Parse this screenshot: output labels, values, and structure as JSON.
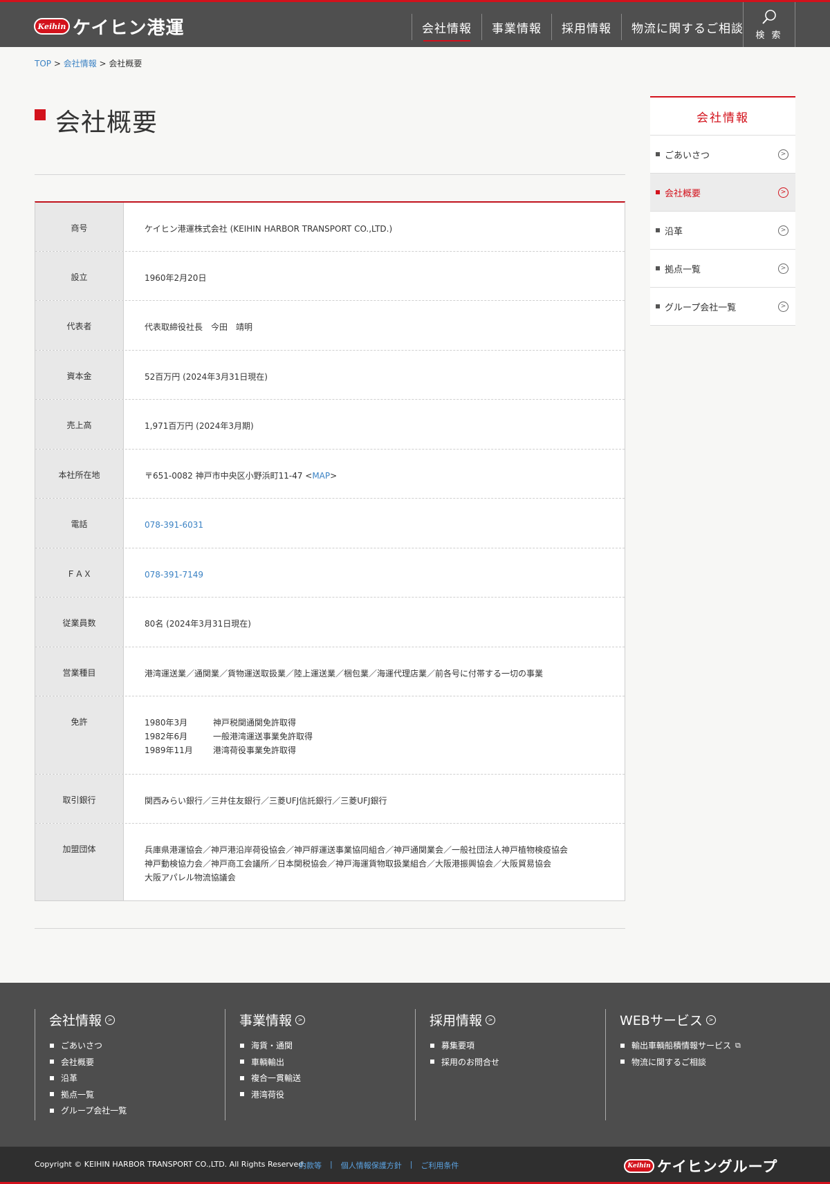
{
  "header": {
    "logo_badge": "Keihin",
    "logo_text": "ケイヒン港運",
    "nav": [
      {
        "label": "会社情報"
      },
      {
        "label": "事業情報"
      },
      {
        "label": "採用情報"
      },
      {
        "label": "物流に関するご相談"
      }
    ],
    "search_label": "検 索"
  },
  "breadcrumb": {
    "top": "TOP",
    "sep1": " > ",
    "company": "会社情報",
    "sep2": " > ",
    "current": "会社概要"
  },
  "page_title": "会社概要",
  "profile": {
    "rows": [
      {
        "label": "商号",
        "value": "ケイヒン港運株式会社 (KEIHIN HARBOR TRANSPORT CO.,LTD.)"
      },
      {
        "label": "設立",
        "value": "1960年2月20日"
      },
      {
        "label": "代表者",
        "value": "代表取締役社長　今田　靖明"
      },
      {
        "label": "資本金",
        "value": "52百万円 (2024年3月31日現在)"
      },
      {
        "label": "売上高",
        "value": "1,971百万円 (2024年3月期)"
      },
      {
        "label": "本社所在地",
        "value": "〒651-0082 神戸市中央区小野浜町11-47 <",
        "link": "MAP",
        "suffix": ">"
      },
      {
        "label": "電話",
        "link": "078-391-6031"
      },
      {
        "label": "ＦＡＸ",
        "link": "078-391-7149"
      },
      {
        "label": "従業員数",
        "value": "80名 (2024年3月31日現在)"
      },
      {
        "label": "営業種目",
        "value": "港湾運送業／通関業／貨物運送取扱業／陸上運送業／梱包業／海運代理店業／前各号に付帯する一切の事業"
      },
      {
        "label": "免許",
        "lines": [
          {
            "date": "1980年3月",
            "text": "神戸税関通関免許取得"
          },
          {
            "date": "1982年6月",
            "text": "一般港湾運送事業免許取得"
          },
          {
            "date": "1989年11月",
            "text": "港湾荷役事業免許取得"
          }
        ]
      },
      {
        "label": "取引銀行",
        "value": "関西みらい銀行／三井住友銀行／三菱UFJ信託銀行／三菱UFJ銀行"
      },
      {
        "label": "加盟団体",
        "lines3": [
          "兵庫県港運協会／神戸港沿岸荷役協会／神戸艀運送事業協同組合／神戸通関業会／一般社団法人神戸植物検疫協会",
          "神戸動検協力会／神戸商工会議所／日本関税協会／神戸海運貨物取扱業組合／大阪港振興協会／大阪貿易協会",
          "大阪アパレル物流協議会"
        ]
      }
    ]
  },
  "sidebar": {
    "title": "会社情報",
    "items": [
      {
        "label": "ごあいさつ"
      },
      {
        "label": "会社概要"
      },
      {
        "label": "沿革"
      },
      {
        "label": "拠点一覧"
      },
      {
        "label": "グループ会社一覧"
      }
    ]
  },
  "footer": {
    "columns": [
      {
        "title": "会社情報",
        "items": [
          "ごあいさつ",
          "会社概要",
          "沿革",
          "拠点一覧",
          "グループ会社一覧"
        ]
      },
      {
        "title": "事業情報",
        "items": [
          "海貨・通関",
          "車輌輸出",
          "複合一貫輸送",
          "港湾荷役"
        ]
      },
      {
        "title": "採用情報",
        "items": [
          "募集要項",
          "採用のお問合せ"
        ]
      },
      {
        "title": "WEBサービス",
        "items": [
          "輸出車輌船積情報サービス",
          "物流に関するご相談"
        ]
      }
    ],
    "copyright": "Copyright © KEIHIN HARBOR TRANSPORT CO.,LTD. All Rights Reserved.",
    "links": [
      "約款等",
      "個人情報保護方針",
      "ご利用条件"
    ],
    "separator": "|",
    "group_logo_badge": "Keihin",
    "group_logo_text": "ケイヒングループ"
  },
  "colors": {
    "accent": "#d3121c",
    "header_bg": "#4f4f4f",
    "footer_bg": "#4d4d4d",
    "copybar_bg": "#2f2f2f",
    "link": "#3b82c4"
  },
  "icons": {
    "search": "magnifier-icon",
    "arrow": "circle-arrow-right-icon",
    "external": "external-link-icon"
  }
}
